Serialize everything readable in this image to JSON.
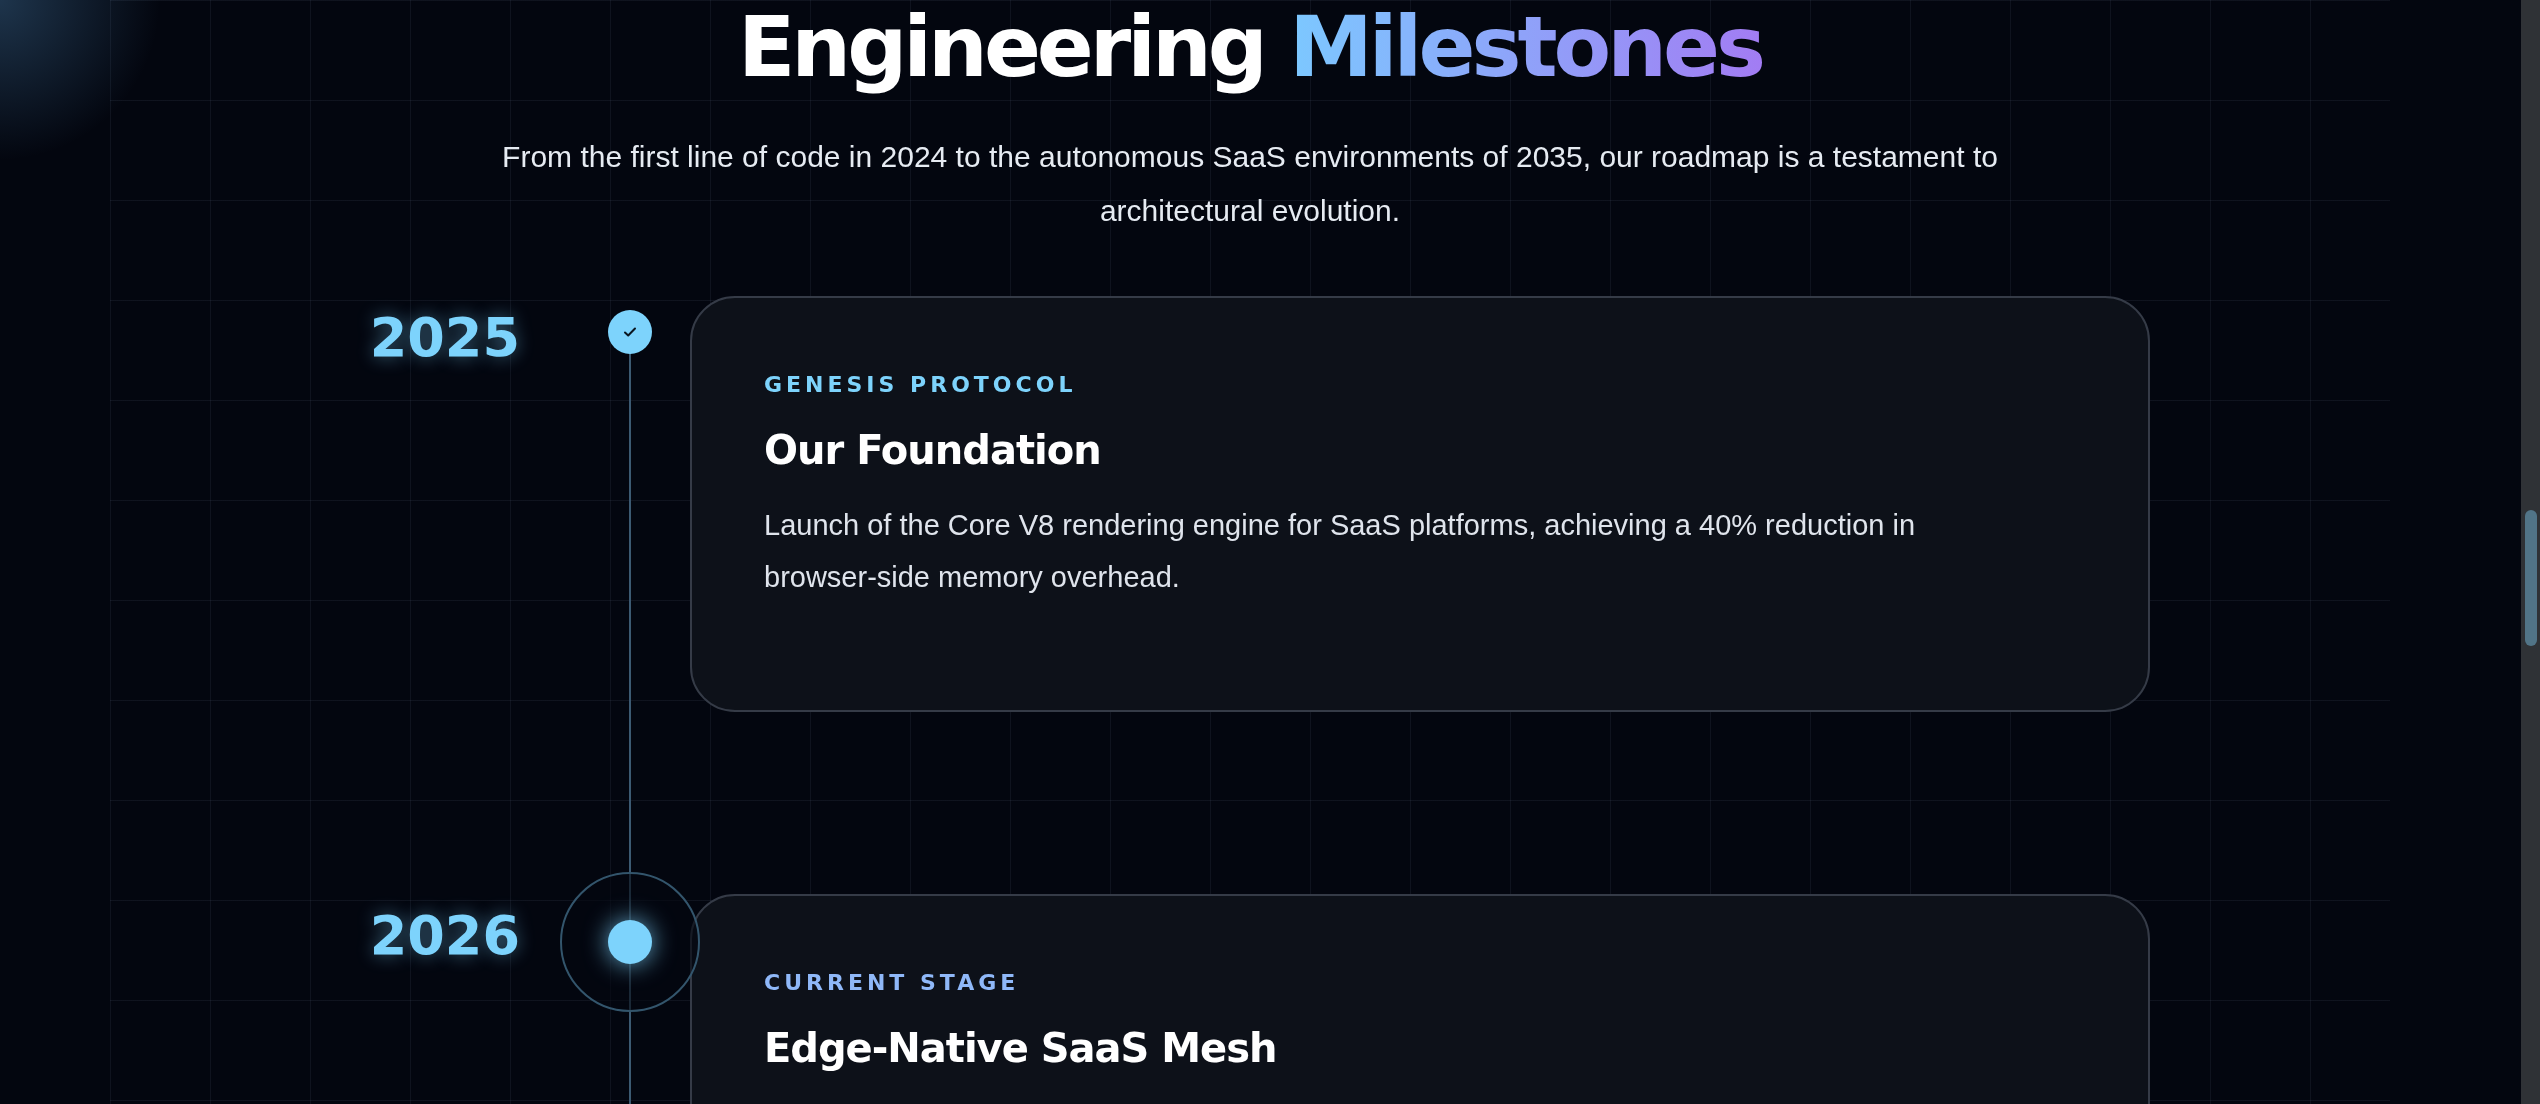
{
  "heading": {
    "plain": "Engineering",
    "highlight": "Milestones"
  },
  "subtitle": "From the first line of code in 2024 to the autonomous SaaS environments of 2035, our roadmap is a testament to architectural evolution.",
  "milestones": [
    {
      "year": "2025",
      "kind": "completed",
      "category": "GENESIS PROTOCOL",
      "title": "Our Foundation",
      "description": "Launch of the Core V8 rendering engine for SaaS platforms, achieving a 40% reduction in browser-side memory overhead."
    },
    {
      "year": "2026",
      "kind": "current",
      "category": "CURRENT STAGE",
      "title": "Edge-Native SaaS Mesh"
    }
  ]
}
